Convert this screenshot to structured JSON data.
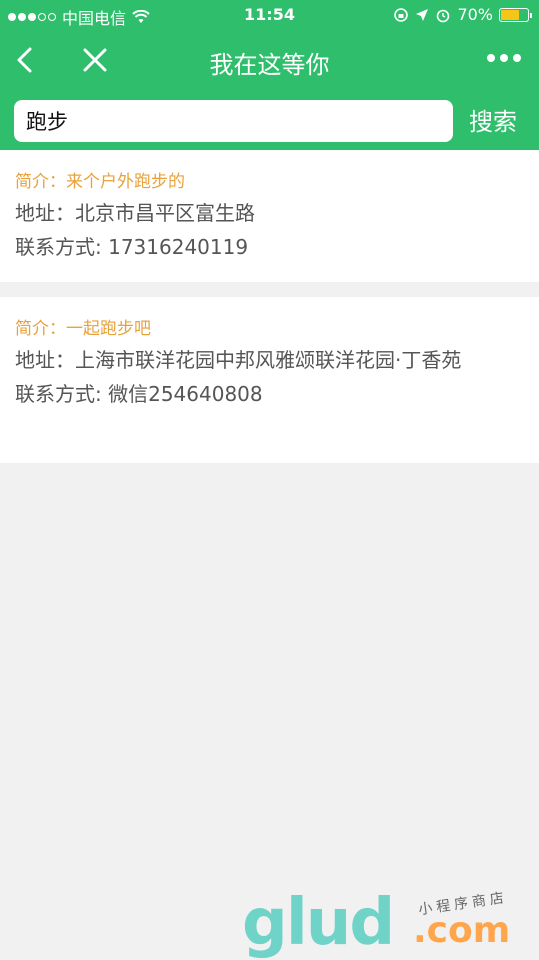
{
  "status_bar": {
    "carrier": "中国电信",
    "time": "11:54",
    "battery_percent": "70%",
    "battery_level": 0.7,
    "colors": {
      "bar": "#2fbf6c",
      "battery": "#f5c518"
    }
  },
  "nav": {
    "title": "我在这等你",
    "back_icon": "chevron-left-icon",
    "close_icon": "close-icon",
    "more_icon": "more-dots-icon"
  },
  "search": {
    "value": "跑步",
    "button_label": "搜索"
  },
  "results": [
    {
      "intro_label": "简介：",
      "intro": "来个户外跑步的",
      "address_label": "地址：",
      "address": "北京市昌平区富生路",
      "contact_label": "联系方式: ",
      "contact": "17316240119"
    },
    {
      "intro_label": "简介：",
      "intro": "一起跑步吧",
      "address_label": "地址：",
      "address": "上海市联洋花园中邦风雅颂联洋花园·丁香苑",
      "contact_label": "联系方式: ",
      "contact": "微信254640808"
    }
  ],
  "watermark": {
    "brand": "glud",
    "domain": ".com",
    "tagline": "小程序商店"
  },
  "colors": {
    "accent": "#2fbf6c",
    "intro_text": "#e9a23b",
    "body_text": "#555555",
    "background": "#f1f1f1"
  }
}
